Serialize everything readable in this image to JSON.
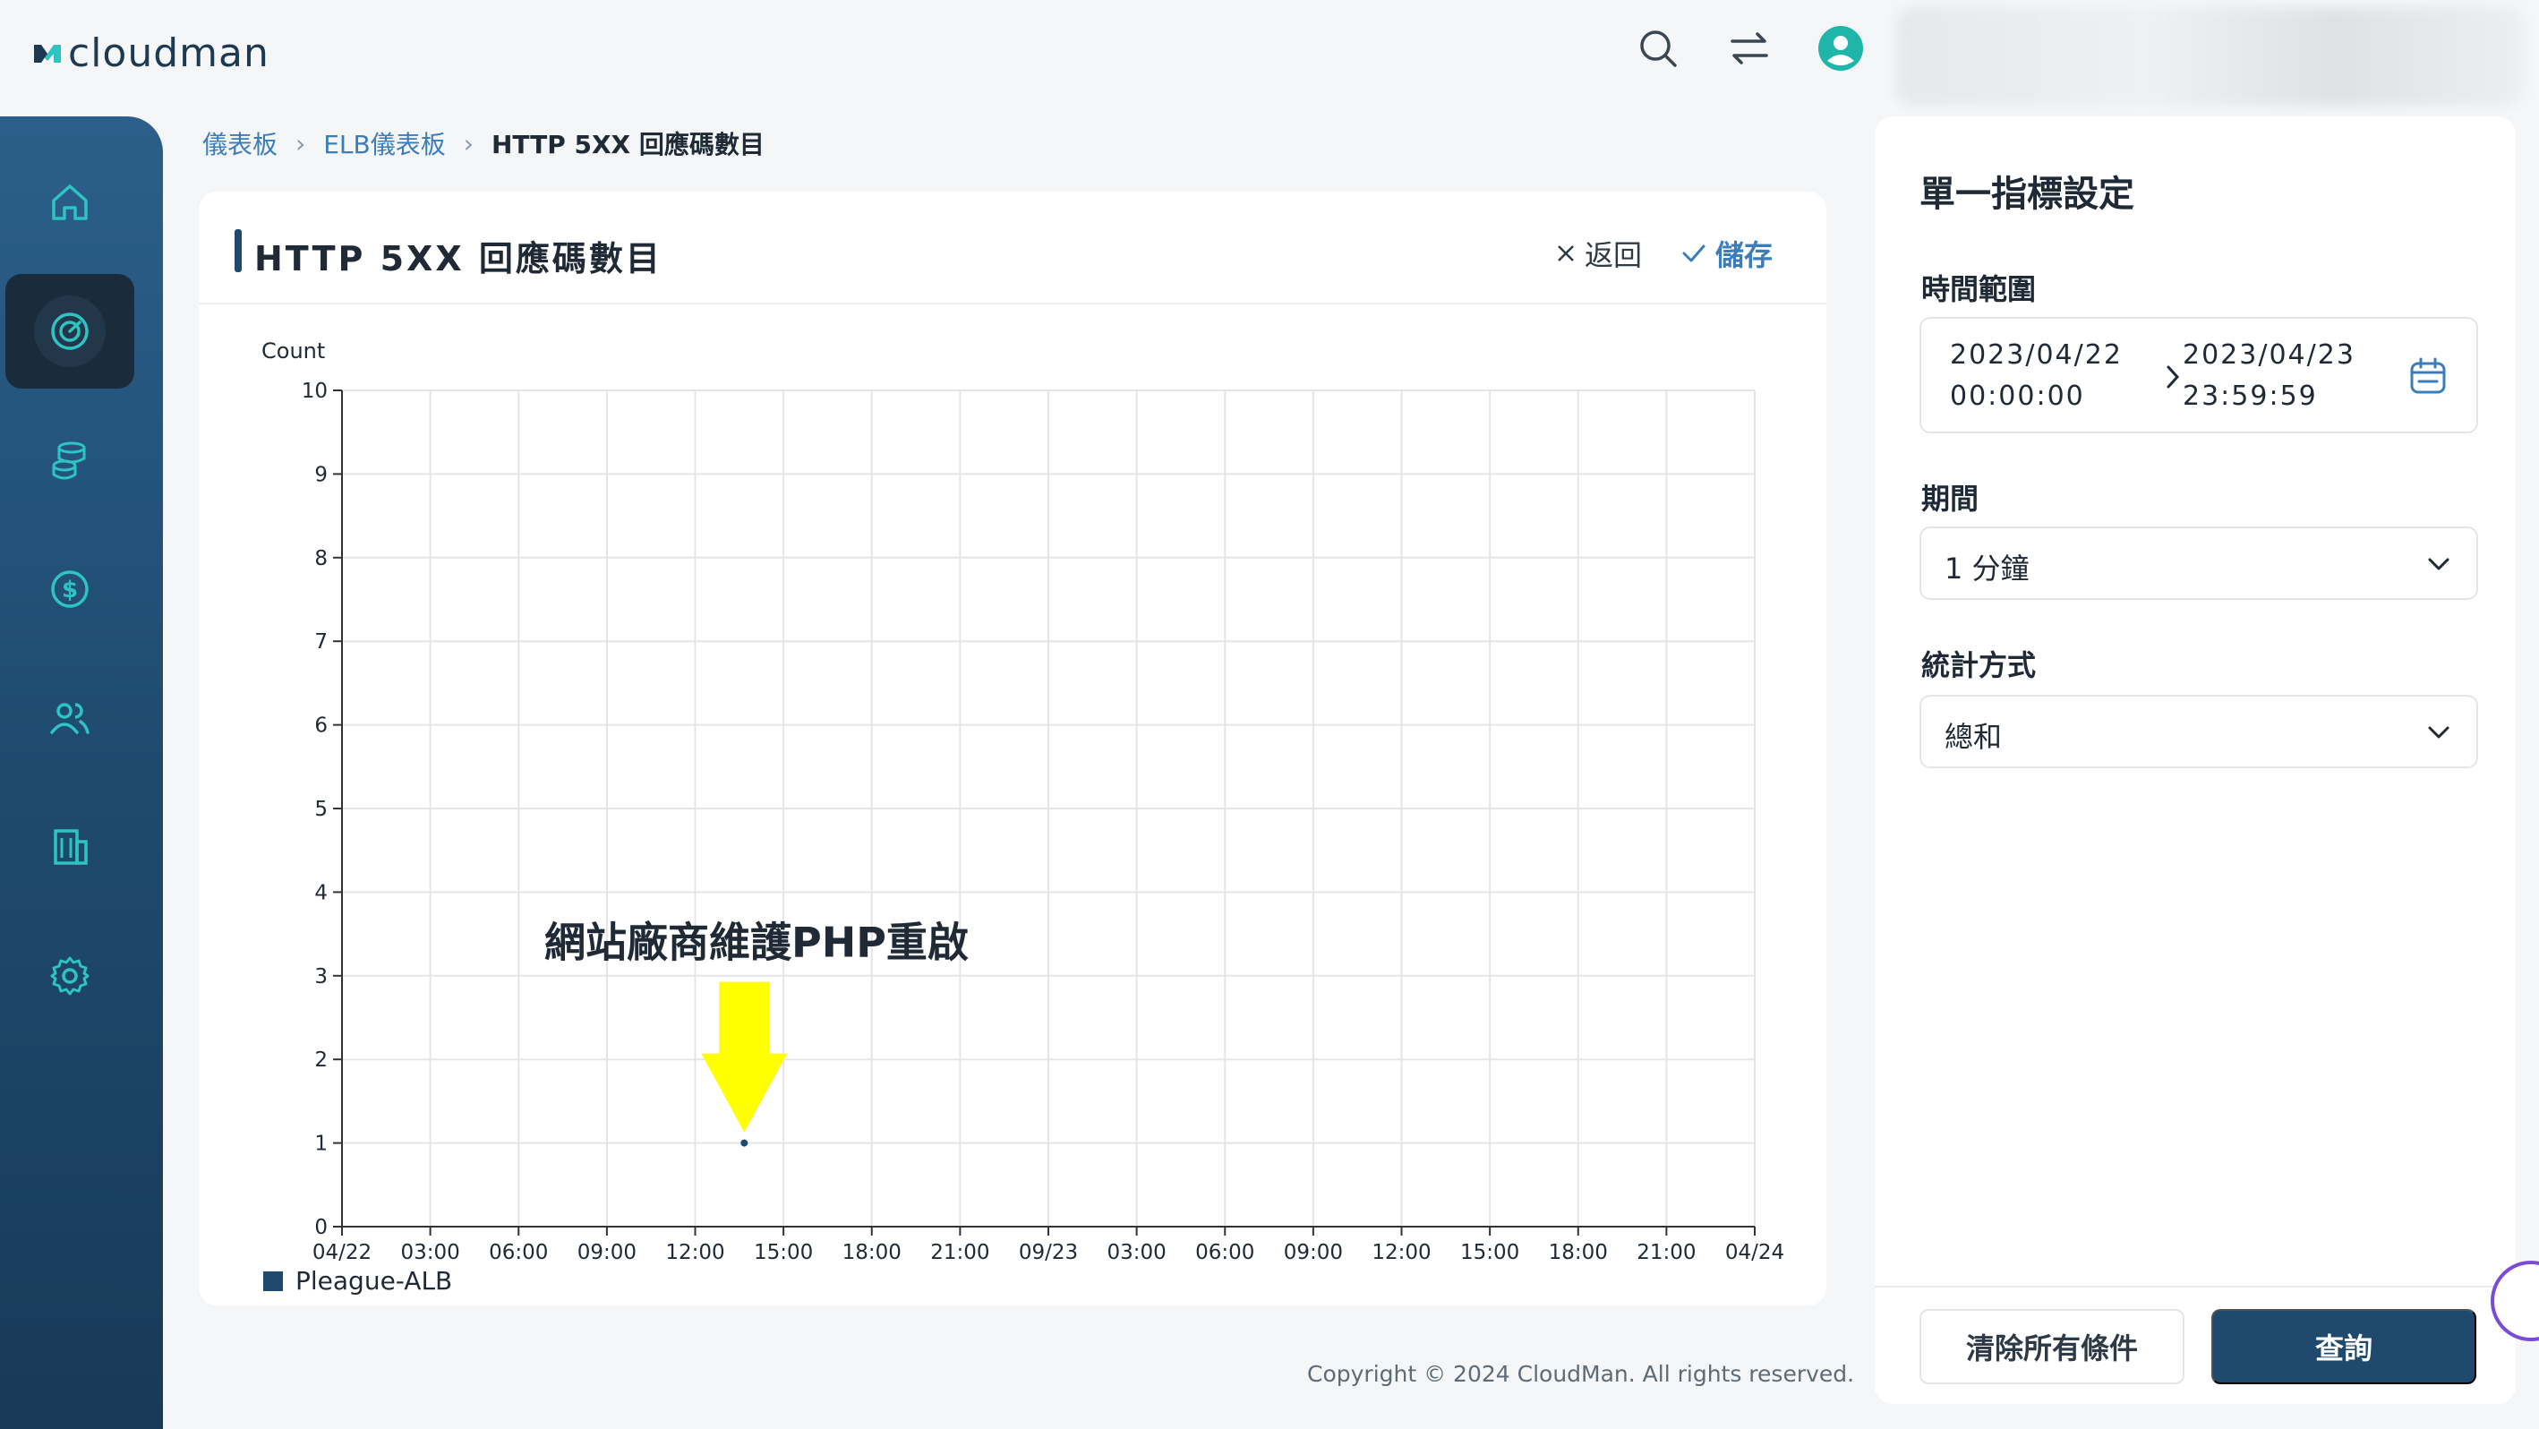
{
  "app": {
    "logo_text": "cloudman"
  },
  "breadcrumb": {
    "items": [
      "儀表板",
      "ELB儀表板"
    ],
    "current": "HTTP 5XX 回應碼數目"
  },
  "card": {
    "title": "HTTP 5XX 回應碼數目",
    "back_label": "返回",
    "save_label": "儲存"
  },
  "sidebar": {
    "items": [
      {
        "icon": "home-icon"
      },
      {
        "icon": "dashboard-gauge-icon",
        "active": true
      },
      {
        "icon": "database-coins-icon"
      },
      {
        "icon": "dollar-icon"
      },
      {
        "icon": "users-icon"
      },
      {
        "icon": "building-icon"
      },
      {
        "icon": "gear-icon"
      }
    ]
  },
  "chart_data": {
    "type": "scatter",
    "ylabel": "Count",
    "ylim": [
      0,
      10
    ],
    "yticks": [
      0,
      1,
      2,
      3,
      4,
      5,
      6,
      7,
      8,
      9,
      10
    ],
    "xticks": [
      "04/22",
      "03:00",
      "06:00",
      "09:00",
      "12:00",
      "15:00",
      "18:00",
      "21:00",
      "09/23",
      "03:00",
      "06:00",
      "09:00",
      "12:00",
      "15:00",
      "18:00",
      "21:00",
      "04/24"
    ],
    "series": [
      {
        "name": "Pleague-ALB",
        "color": "#1f4a6e",
        "points": [
          {
            "x": "2023/04/22 13:40",
            "y": 1
          }
        ]
      }
    ],
    "annotation": {
      "text": "網站廠商維護PHP重啟",
      "target_x": "2023/04/22 13:40",
      "target_y": 1,
      "arrow_color": "#ffff00"
    },
    "grid": true,
    "legend": "bottom-left"
  },
  "panel": {
    "title": "單一指標設定",
    "time_range_label": "時間範圍",
    "start_date": "2023/04/22",
    "start_time": "00:00:00",
    "end_date": "2023/04/23",
    "end_time": "23:59:59",
    "period_label": "期間",
    "period_value": "1 分鐘",
    "stat_label": "統計方式",
    "stat_value": "總和",
    "clear_label": "清除所有條件",
    "query_label": "查詢"
  },
  "footer": {
    "copyright": "Copyright © 2024 CloudMan. All rights reserved."
  }
}
